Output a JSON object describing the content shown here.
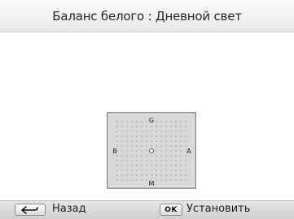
{
  "header": {
    "title": "Баланс белого : Дневной свет"
  },
  "wb_grid": {
    "top_label": "G",
    "bottom_label": "M",
    "left_label": "B",
    "right_label": "A"
  },
  "footer": {
    "back_icon": "back-arrow-icon",
    "back_label": "Назад",
    "ok_key": "OK",
    "set_label": "Установить"
  }
}
